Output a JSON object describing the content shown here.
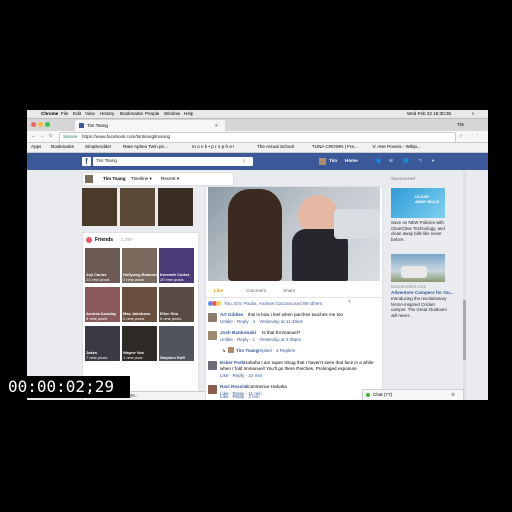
{
  "mac_menubar": {
    "app": "Chrome",
    "menus": [
      "File",
      "Edit",
      "View",
      "History",
      "Bookmarks",
      "People",
      "Window",
      "Help"
    ],
    "clock": "Wed Feb 22  18:30:36"
  },
  "browser": {
    "tab_title": "Tim Tsang",
    "user_badge": "Tim",
    "secure_label": "Secure",
    "url": "https://www.facebook.com/timtsangtimsang",
    "bookmarks": [
      "Apps",
      "Bookmarks",
      "SimpleAdder",
      "Rare Aphex Twin pe...",
      "m o n k • p r o p h e t",
      "The Actual School",
      "TUNA CROWN | Fre...",
      "'o' Arte Povera - Wikip..."
    ]
  },
  "facebook": {
    "search_value": "Tim Tsang",
    "nav": {
      "profile_name": "Tim",
      "home": "Home"
    },
    "cover_tabs": [
      "Tim Tsang",
      "Timeline ▾",
      "Recent ▾"
    ],
    "friends": {
      "title": "Friends",
      "count": "· 1,797",
      "items": [
        {
          "name": "Joji Carlos",
          "posts": "10 new posts"
        },
        {
          "name": "Hollyweg Bolanos",
          "posts": "3 new posts"
        },
        {
          "name": "Kenneth Cortez",
          "posts": "20 new posts"
        },
        {
          "name": "Andrea Azoulay",
          "posts": "4 new posts"
        },
        {
          "name": "Max Jakobsen",
          "posts": "2 new posts"
        },
        {
          "name": "Ellen Shu",
          "posts": "6 new posts"
        },
        {
          "name": "Jakes",
          "posts": "7 new posts"
        },
        {
          "name": "Wayne Vos",
          "posts": "1 new post"
        },
        {
          "name": "Stephen Ruff",
          "posts": ""
        }
      ]
    },
    "status_url": "...1019e1529171245848...",
    "post": {
      "actions": [
        "Like",
        "Comment",
        "Share"
      ],
      "reactions_text": "You, Eric Poulin, Andrew Gazzara and 88 others",
      "comments": [
        {
          "author": "Art Gibbes",
          "text": "this is how i feel when parches touches me too",
          "meta": "Unlike · Reply · 4 · Yesterday at 11:49am"
        },
        {
          "author": "Josh Bankowski",
          "text": "Is that Emmanuel?",
          "meta": "Unlike · Reply · 1 · Yesterday at 2:39pm"
        },
        {
          "author": "Tim Tsang",
          "text": "replied · 3 Replies",
          "meta": ""
        },
        {
          "author": "Esber Park",
          "text": "Hahaha I am super timug that I haven't seen that face in a while when I fold Immanuel! You'll go there Parches. Prolonged exposure",
          "meta": "Like · Reply · 22 min"
        },
        {
          "author": "Ravi Rossini",
          "text": "Commence Hahaha",
          "meta": "Like · Reply · 11 min"
        },
        {
          "author": "",
          "text": "",
          "meta": "Like · Reply · 2 min"
        }
      ]
    },
    "sponsored": {
      "title": "Sponsored",
      "ad1": {
        "image_text": "CLEAR AWAY BILLS",
        "text": "Save on NEW Policies with ClearClear Technology, and clean away bills like never before."
      },
      "ad2": {
        "domain": "tacleomdore.com",
        "title": "Adventure Campers for Ou...",
        "text": "Introducing the revolutionary NASA-inspired Cricket camper. The Great Outdoors will never..."
      }
    },
    "chat": "Chat (77)"
  },
  "timecode": "00:00:02;29"
}
